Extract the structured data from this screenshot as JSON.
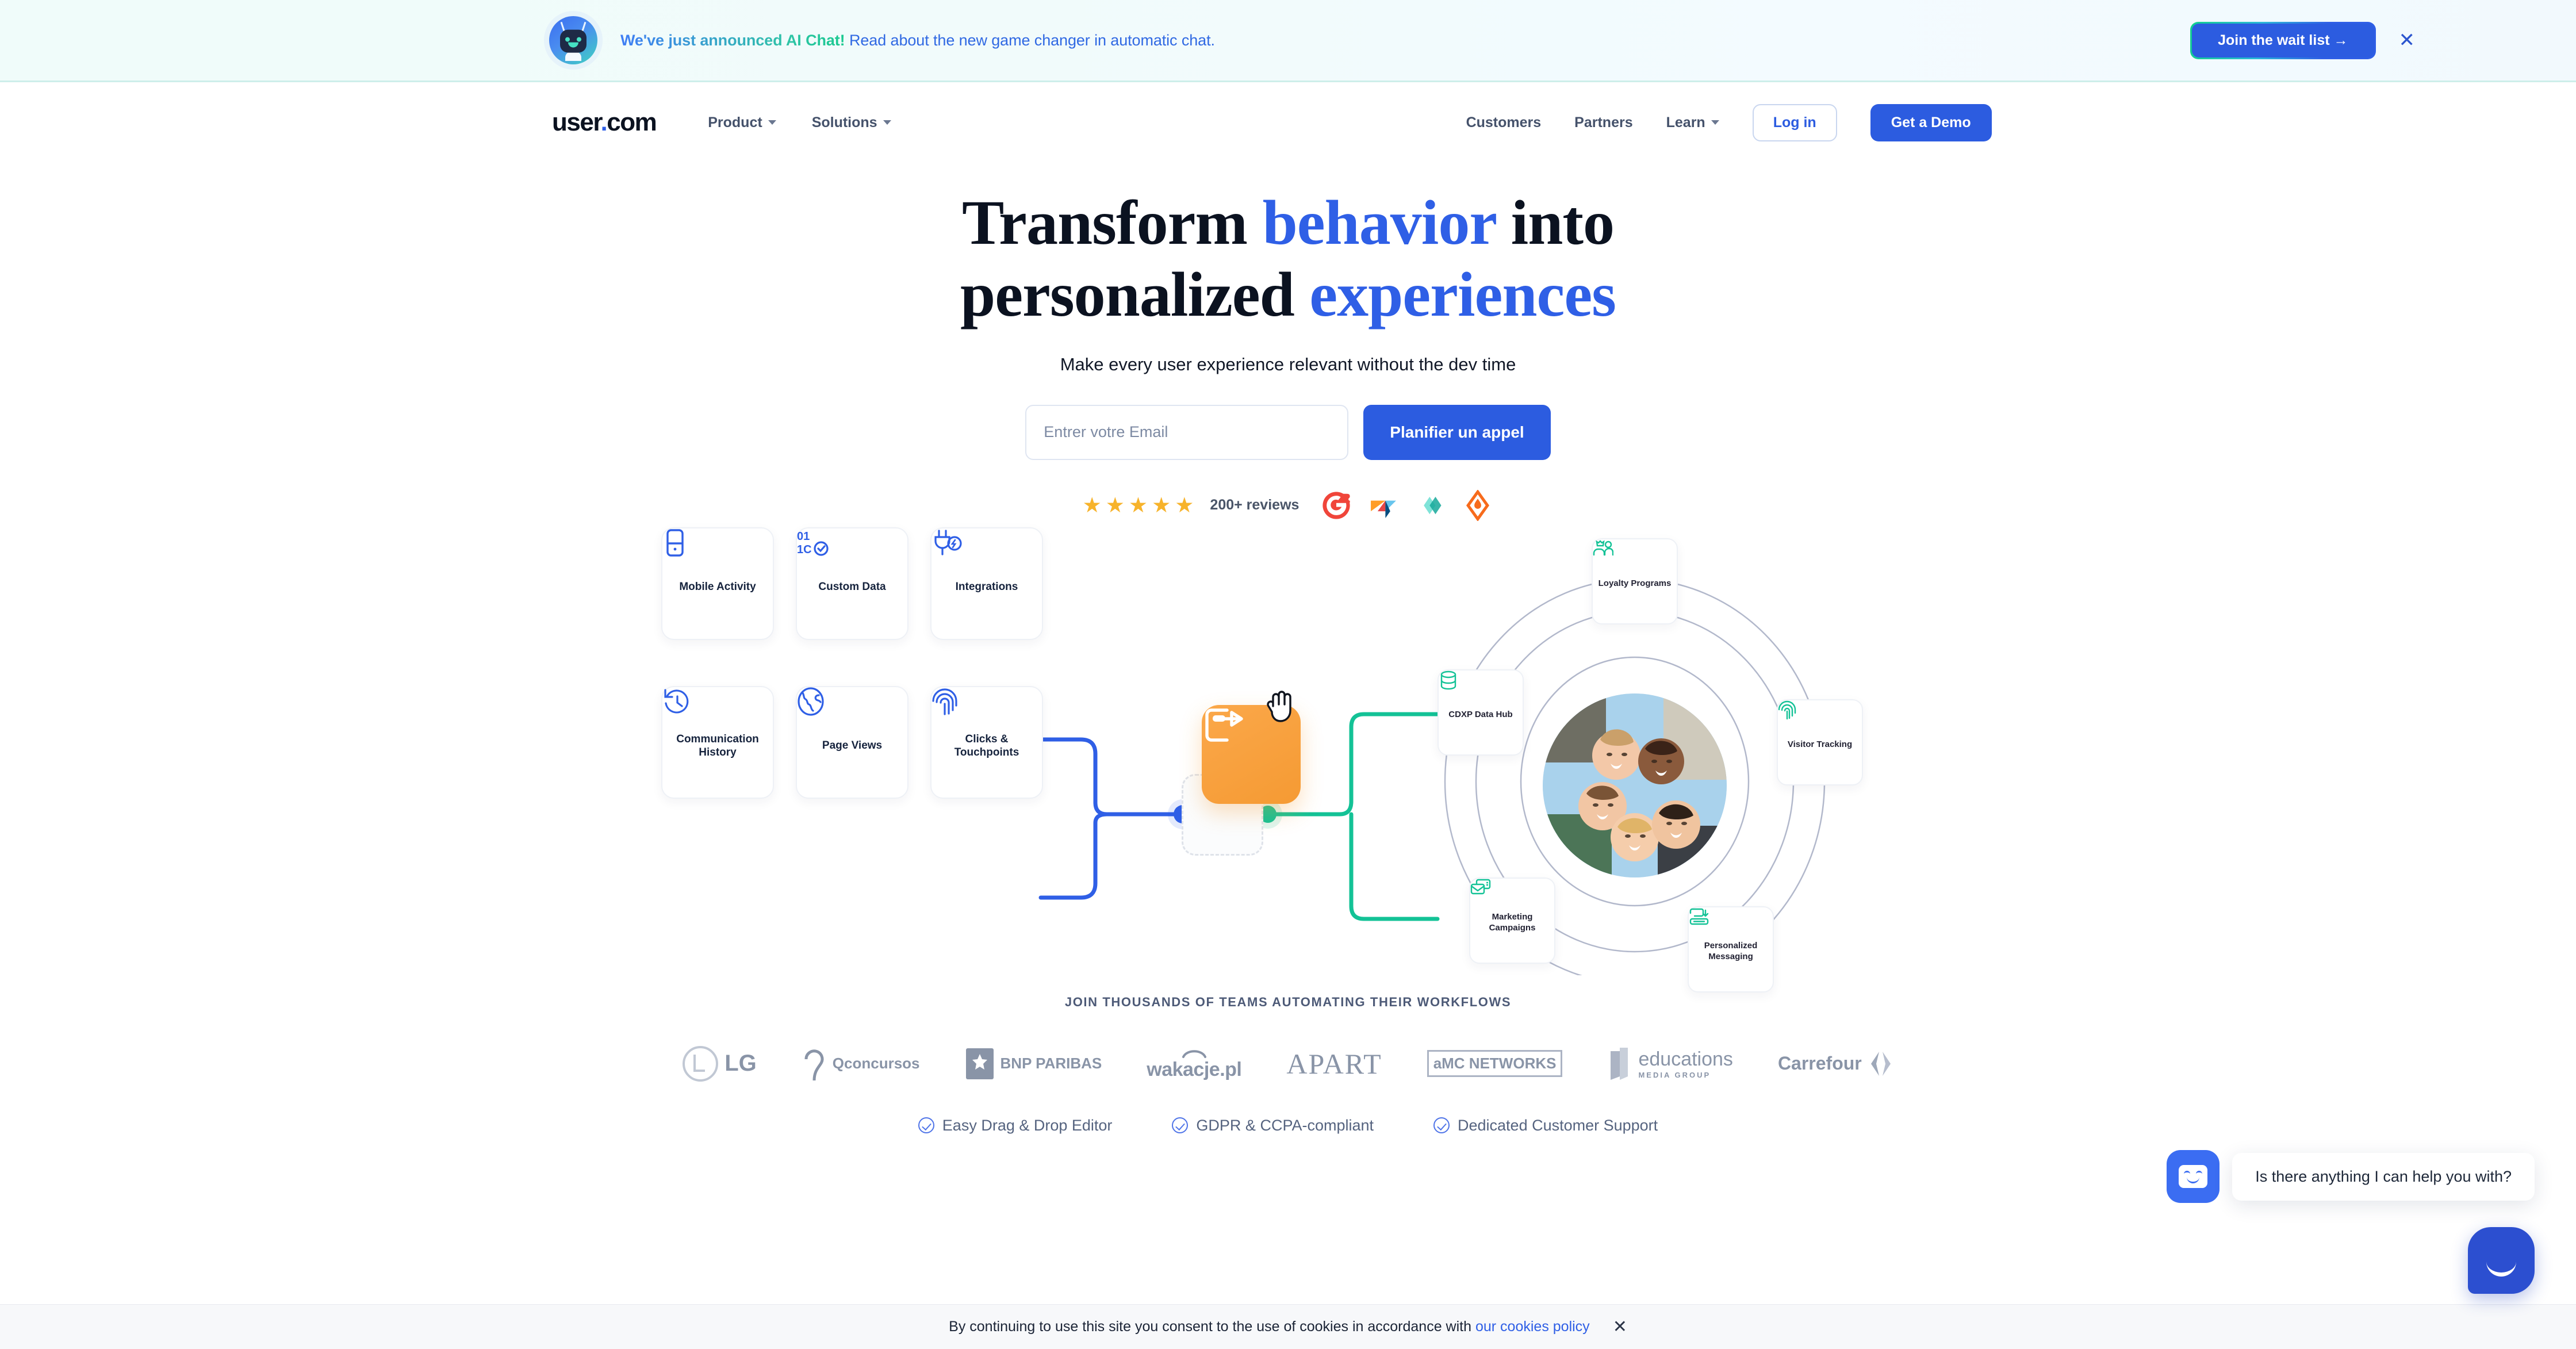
{
  "announcement": {
    "robot_icon": "robot-avatar-icon",
    "highlight_text": "We've just announced AI Chat!",
    "rest_text": "Read about the new game changer in automatic chat.",
    "cta_label": "Join the wait list →",
    "close_icon": "close-icon",
    "gradient_from": "#12d08e",
    "gradient_to": "#2f5fe6"
  },
  "nav": {
    "logo_main": "user",
    "logo_dot": ".",
    "logo_tld": "com",
    "left_items": [
      {
        "label": "Product",
        "has_chevron": true
      },
      {
        "label": "Solutions",
        "has_chevron": true
      }
    ],
    "right_items": [
      {
        "label": "Customers",
        "has_chevron": false
      },
      {
        "label": "Partners",
        "has_chevron": false
      },
      {
        "label": "Learn",
        "has_chevron": true
      }
    ],
    "login_label": "Log in",
    "demo_label": "Get a Demo"
  },
  "hero": {
    "title_part1": "Transform ",
    "title_blue1": "behavior",
    "title_part2": " into",
    "title_part3": "personalized ",
    "title_blue2": "experiences",
    "subtitle": "Make every user experience relevant without the dev time",
    "email_placeholder": "Entrer votre Email",
    "email_value": "",
    "submit_label": "Planifier un appel",
    "accent_color": "#2f5fe6"
  },
  "reviews": {
    "star_count": 5,
    "star_glyph": "★",
    "star_color": "#f7b32b",
    "label": "200+ reviews",
    "badges": [
      "g2-badge-icon",
      "capterra-badge-icon",
      "getapp-badge-icon",
      "software-advice-badge-icon"
    ]
  },
  "diagram": {
    "left_cards": [
      {
        "label": "Mobile Activity",
        "icon": "mobile-phone-icon"
      },
      {
        "label": "Custom Data",
        "icon": "binary-check-icon"
      },
      {
        "label": "Integrations",
        "icon": "plug-bolt-icon"
      },
      {
        "label": "Communication History",
        "icon": "history-clock-icon"
      },
      {
        "label": "Page Views",
        "icon": "globe-icon"
      },
      {
        "label": "Clicks & Touchpoints",
        "icon": "fingerprint-icon"
      }
    ],
    "center": {
      "icon": "send-export-icon",
      "color": "#f59a33",
      "cursor": "grab-hand-cursor"
    },
    "right_cards": [
      {
        "label": "Loyalty Programs",
        "icon": "loyalty-users-icon"
      },
      {
        "label": "CDXP Data Hub",
        "icon": "database-icon"
      },
      {
        "label": "Visitor Tracking",
        "icon": "fingerprint-icon"
      },
      {
        "label": "Marketing Campaigns",
        "icon": "mail-stack-icon"
      },
      {
        "label": "Personalized Messaging",
        "icon": "message-arrow-icon"
      }
    ],
    "hub_photo_alt": "group-of-people-photo",
    "line_color_left": "#2f5fe6",
    "line_color_right": "#13c296"
  },
  "logos": {
    "title": "JOIN THOUSANDS OF TEAMS AUTOMATING THEIR WORKFLOWS",
    "items": [
      {
        "name": "LG"
      },
      {
        "name": "Qconcursos"
      },
      {
        "name": "BNP PARIBAS"
      },
      {
        "name": "wakacje.pl"
      },
      {
        "name": "APART"
      },
      {
        "name": "aMC NETWORKS"
      },
      {
        "name": "educations",
        "sub": "MEDIA GROUP"
      },
      {
        "name": "Carrefour"
      }
    ]
  },
  "features": [
    {
      "label": "Easy Drag & Drop Editor",
      "icon": "check-circle-icon"
    },
    {
      "label": "GDPR & CCPA-compliant",
      "icon": "check-circle-icon"
    },
    {
      "label": "Dedicated Customer Support",
      "icon": "check-circle-icon"
    }
  ],
  "cookie": {
    "text": "By continuing to use this site you consent to the use of cookies in accordance with ",
    "link_label": "our cookies policy",
    "close_icon": "close-icon"
  },
  "chat": {
    "avatar_icon": "smiley-avatar-icon",
    "message": "Is there anything I can help you with?",
    "launcher_icon": "chat-smile-icon",
    "launcher_color": "#2c4fd0"
  }
}
